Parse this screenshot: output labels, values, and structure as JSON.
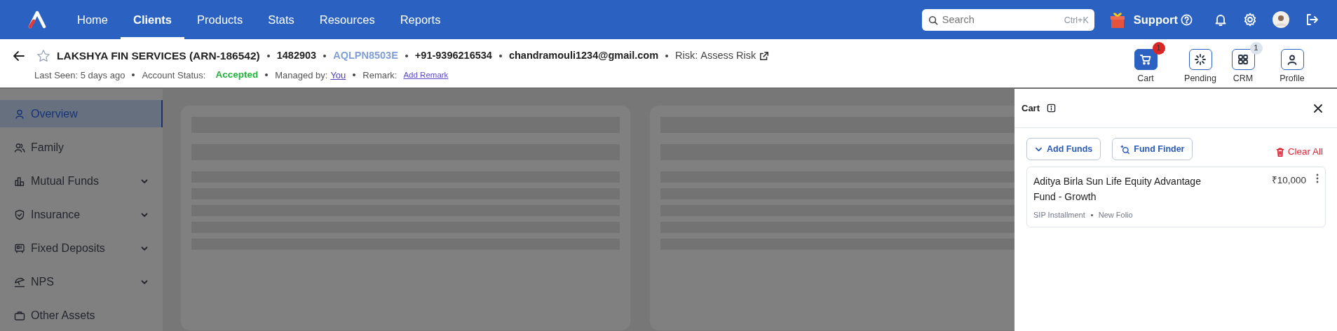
{
  "nav": {
    "items": [
      {
        "label": "Home",
        "selected": false
      },
      {
        "label": "Clients",
        "selected": true
      },
      {
        "label": "Products",
        "selected": false
      },
      {
        "label": "Stats",
        "selected": false
      },
      {
        "label": "Resources",
        "selected": false
      },
      {
        "label": "Reports",
        "selected": false
      }
    ],
    "search": {
      "placeholder": "Search",
      "shortcut": "Ctrl+K"
    },
    "support": "Support"
  },
  "client": {
    "name": "LAKSHYA FIN SERVICES (ARN-186542)",
    "starred": false,
    "code": "1482903",
    "pan": "AQLPN8503E",
    "phone": "+91-9396216534",
    "email": "chandramouli1234@gmail.com",
    "risk_label": "Risk:",
    "risk_link": "Assess Risk",
    "last_seen": "Last Seen: 5 days ago",
    "status_label": "Account Status:",
    "status": "Accepted",
    "managed_label": "Managed by:",
    "managed_by": "You",
    "remark_label": "Remark:",
    "remark_link": "Add Remark"
  },
  "actions": [
    {
      "kind": "cart",
      "label": "Cart",
      "selected": true,
      "badge": "1",
      "color": "#dc2626"
    },
    {
      "kind": "pending",
      "label": "Pending",
      "selected": false
    },
    {
      "kind": "crm",
      "label": "CRM",
      "selected": false,
      "badge": "1",
      "color": "#dde3ec"
    },
    {
      "kind": "profile",
      "label": "Profile",
      "selected": false
    }
  ],
  "sidebar": {
    "items": [
      {
        "kind": "person",
        "label": "Overview",
        "selected": true,
        "submenu": false
      },
      {
        "kind": "people",
        "label": "Family",
        "selected": false,
        "submenu": false
      },
      {
        "kind": "chart",
        "label": "Mutual Funds",
        "selected": false,
        "submenu": true
      },
      {
        "kind": "shield",
        "label": "Insurance",
        "selected": false,
        "submenu": true
      },
      {
        "kind": "safe",
        "label": "Fixed Deposits",
        "selected": false,
        "submenu": true
      },
      {
        "kind": "umbrella",
        "label": "NPS",
        "selected": false,
        "submenu": true
      },
      {
        "kind": "bag",
        "label": "Other Assets",
        "selected": false,
        "submenu": false
      }
    ]
  },
  "cart": {
    "title": "Cart",
    "add_funds": "Add Funds",
    "fund_finder": "Fund Finder",
    "clear_all": "Clear All",
    "items": [
      {
        "name": "Aditya Birla Sun Life Equity Advantage Fund - Growth",
        "amount": "₹10,000",
        "type": "SIP Installment",
        "folio": "New Folio"
      }
    ]
  }
}
